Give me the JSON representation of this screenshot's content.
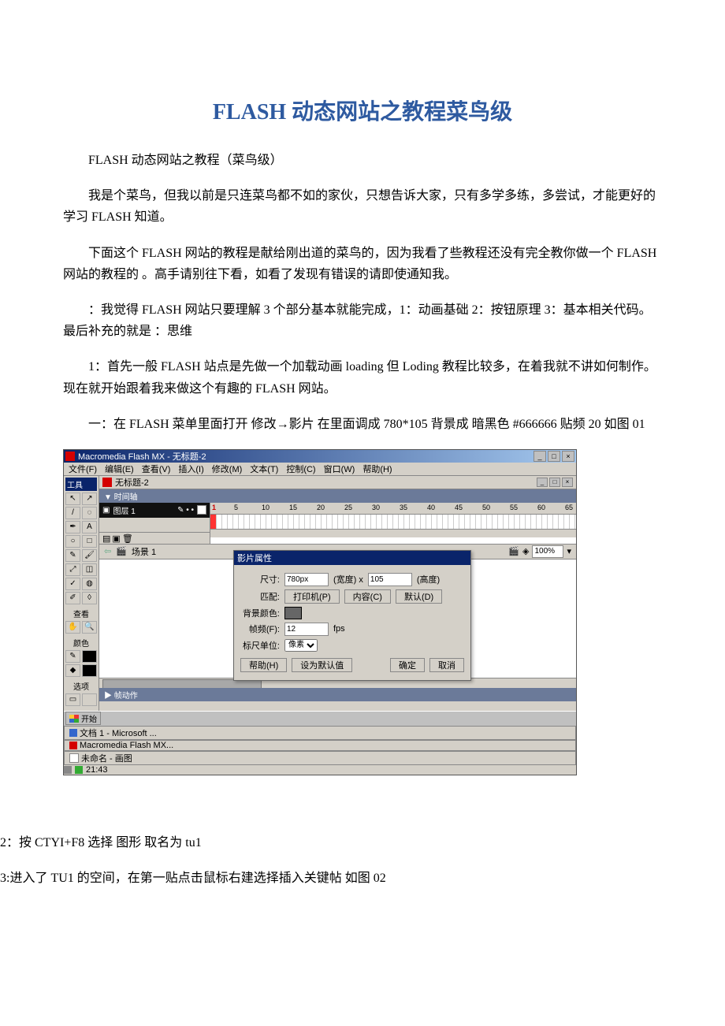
{
  "title": "FLASH 动态网站之教程菜鸟级",
  "paragraphs": {
    "p1": "FLASH 动态网站之教程（菜鸟级）",
    "p2": "我是个菜鸟，但我以前是只连菜鸟都不如的家伙，只想告诉大家，只有多学多练，多尝试，才能更好的学习 FLASH 知道。",
    "p3": "下面这个 FLASH 网站的教程是献给刚出道的菜鸟的，因为我看了些教程还没有完全教你做一个 FLASH 网站的教程的 。高手请别往下看，如看了发现有错误的请即使通知我。",
    "p4": "：我觉得 FLASH 网站只要理解 3 个部分基本就能完成，1：动画基础 2：按钮原理 3：基本相关代码。最后补充的就是 ：思维",
    "p5": "1：首先一般 FLASH 站点是先做一个加载动画 loading 但 Loding 教程比较多，在着我就不讲如何制作。现在就开始跟着我来做这个有趣的 FLASH 网站。",
    "p6": "一：在 FLASH 菜单里面打开 修改→影片 在里面调成 780*105 背景成 暗黑色 #666666 贴频 20 如图 01",
    "p7": "2：按 CTYI+F8 选择 图形 取名为 tu1",
    "p8": "3:进入了 TU1 的空间，在第一贴点击鼠标右建选择插入关键帖 如图 02"
  },
  "flash_window": {
    "app_title": "Macromedia Flash MX - 无标题-2",
    "menus": [
      "文件(F)",
      "编辑(E)",
      "查看(V)",
      "插入(I)",
      "修改(M)",
      "文本(T)",
      "控制(C)",
      "窗口(W)",
      "帮助(H)"
    ],
    "doc_title": "无标题-2",
    "tool_label": "工具",
    "view_label": "查看",
    "color_label": "颜色",
    "option_label": "选项",
    "timeline_label": "▼ 时间轴",
    "layer_name": "图层 1",
    "ruler_ticks": [
      "1",
      "5",
      "10",
      "15",
      "20",
      "25",
      "30",
      "35",
      "40",
      "45",
      "50",
      "55",
      "60",
      "65"
    ],
    "scene_label": "场景 1",
    "zoom_value": "100%",
    "actions_label": "▶ 帧动作",
    "dialog": {
      "title": "影片属性",
      "size_label": "尺寸:",
      "width_value": "780px",
      "width_after": "(宽度)  x",
      "height_value": "105",
      "height_after": "(高度)",
      "match_label": "匹配:",
      "btn_printer": "打印机(P)",
      "btn_content": "内容(C)",
      "btn_default": "默认(D)",
      "bg_label": "背景颜色:",
      "fps_label": "帧频(F):",
      "fps_value": "12",
      "fps_unit": "fps",
      "ruler_label": "标尺单位:",
      "ruler_value": "像素",
      "btn_help": "帮助(H)",
      "btn_setdefault": "设为默认值",
      "btn_ok": "确定",
      "btn_cancel": "取消"
    }
  },
  "taskbar": {
    "start": "开始",
    "tasks": [
      "文档 1 - Microsoft ...",
      "Macromedia Flash MX...",
      "未命名 - 画图"
    ],
    "clock": "21:43"
  }
}
